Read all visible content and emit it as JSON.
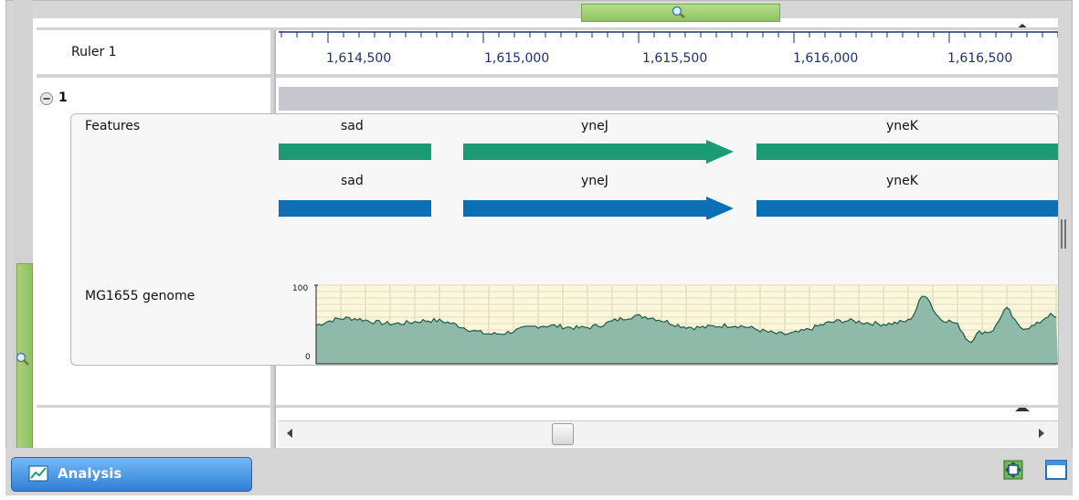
{
  "ruler": {
    "label": "Ruler 1",
    "ticks": [
      "1,614,500",
      "1,615,000",
      "1,615,500",
      "1,616,000",
      "1,616,500"
    ]
  },
  "group": {
    "number": "1"
  },
  "features_track": {
    "label": "Features",
    "genes_top": [
      "sad",
      "yneJ",
      "yneK"
    ],
    "genes_bottom": [
      "sad",
      "yneJ",
      "yneK"
    ],
    "color_top": "#1a9b73",
    "color_bottom": "#0b6fb6"
  },
  "genome_track": {
    "label": "MG1655 genome",
    "y_max": "100",
    "y_min": "0",
    "fill_color": "#8fb9a8",
    "line_color": "#1f5a44"
  },
  "bottom_bar": {
    "analysis_label": "Analysis"
  },
  "icons": [
    "magnifier-icon",
    "collapse-icon",
    "scroll-left-icon",
    "scroll-right-icon",
    "chart-icon",
    "fit-icon",
    "window-icon"
  ]
}
